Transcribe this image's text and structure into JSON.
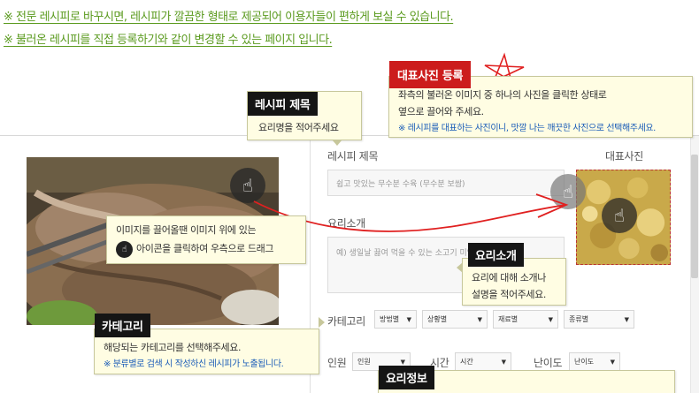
{
  "notices": [
    "※ 전문 레시피로 바꾸시면, 레시피가 깔끔한 형태로 제공되어 이용자들이 편하게 보실 수 있습니다.",
    "※ 불러온 레시피를 직접 등록하기와 같이 변경할 수 있는 페이지 입니다."
  ],
  "form": {
    "title_label": "레시피 제목",
    "title_placeholder": "쉽고 맛있는 무수분 수육 (무수분 보쌈)",
    "photo_label": "대표사진",
    "intro_label": "요리소개",
    "intro_placeholder": "예) 생일날 끓여 먹을 수 있는 소고기 미역국",
    "category_label": "카테고리",
    "category_selects": [
      "방법별",
      "상황별",
      "재료별",
      "종류별"
    ],
    "serving_label": "인원",
    "serving_value": "인원",
    "time_label": "시간",
    "time_value": "시간",
    "level_label": "난이도",
    "level_value": "난이도"
  },
  "tips": {
    "title": {
      "head": "레시피 제목",
      "text": "요리명을 적어주세요"
    },
    "photo": {
      "head": "대표사진 등록",
      "line1": "좌측의 불러온 이미지 중 하나의 사진을 클릭한 상태로",
      "line2": "옆으로 끌어와 주세요.",
      "note": "※ 레시피를 대표하는 사진이니, 맛깔 나는 깨끗한 사진으로 선택해주세요."
    },
    "drag": {
      "line1": "이미지를 끌어올땐 이미지 위에 있는",
      "line2": "아이콘을 클릭하여 우측으로 드래그"
    },
    "intro": {
      "head": "요리소개",
      "line1": "요리에 대해 소개나",
      "line2": "설명을 적어주세요."
    },
    "category": {
      "head": "카테고리",
      "line1": "해당되는 카테고리를 선택해주세요.",
      "note": "※ 분류별로 검색 시 작성하신 레시피가 노출됩니다."
    },
    "info": {
      "head": "요리정보"
    }
  },
  "icons": {
    "drag_hand": "hand-pointer-icon",
    "caret": "caret-down-icon",
    "star_mark": "star-scribble-icon"
  },
  "colors": {
    "notice_green": "#5a9a1e",
    "tip_background": "#fffde3",
    "tip_head_dark": "#151515",
    "tip_head_red": "#cc1c1c",
    "note_blue": "#1b5db8",
    "drag_line_red": "#e02020"
  }
}
